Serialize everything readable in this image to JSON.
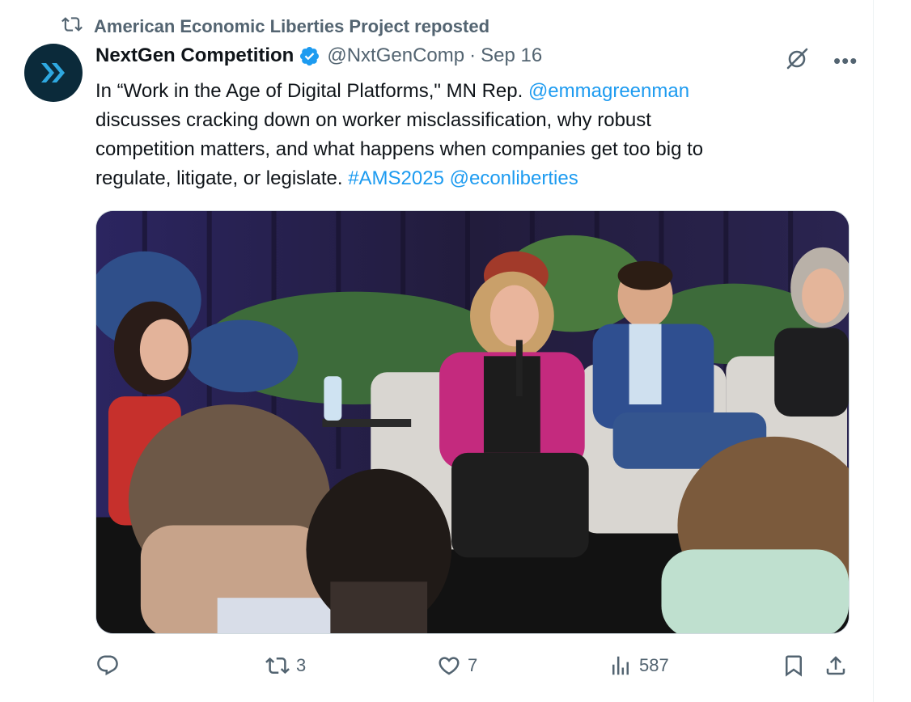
{
  "repost": {
    "text": "American Economic Liberties Project reposted",
    "icon": "repost-icon"
  },
  "author": {
    "name": "NextGen Competition",
    "handle": "@NxtGenComp",
    "separator": "·",
    "date": "Sep 16",
    "verified": true
  },
  "tweet": {
    "line1_text": "In “Work in the Age of Digital Platforms,\" MN Rep. ",
    "line1_mention": "@emmagreenman",
    "line2": "discusses cracking down on worker misclassification, why robust",
    "line3": "competition matters, and what happens when companies get too big to",
    "line4_text": "regulate, litigate, or legislate. ",
    "line4_hashtag": "#AMS2025",
    "line4_mention": "@econliberties"
  },
  "media": {
    "alt": "Panel discussion photo with speakers seated on stage"
  },
  "actions": {
    "replies": "",
    "reposts": "3",
    "likes": "7",
    "views": "587"
  },
  "colors": {
    "link": "#1d9bf0",
    "muted": "#536471",
    "text": "#0f1419",
    "verified": "#1d9bf0",
    "avatar_bg": "#0b2a3a",
    "avatar_accent": "#2ea8e0"
  }
}
